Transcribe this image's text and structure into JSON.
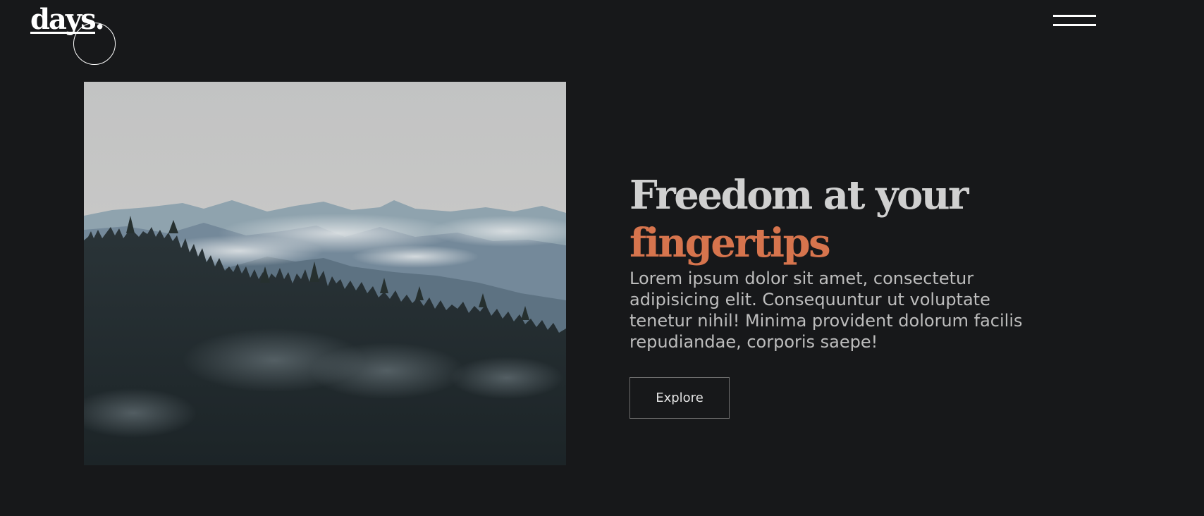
{
  "header": {
    "logo_text": "days.",
    "menu_icon": "hamburger-icon"
  },
  "hero": {
    "image_alt_icon": "mountain-forest-photo",
    "headline_line1": "Freedom at your",
    "headline_line2": "fingertips",
    "body": "Lorem ipsum dolor sit amet, consectetur adipisicing elit. Consequuntur ut voluptate tenetur nihil! Minima provident dolorum facilis repudiandae, corporis saepe!",
    "cta_label": "Explore"
  },
  "colors": {
    "background": "#17181a",
    "accent": "#d6744d",
    "headline": "#d0d0d0",
    "body_text": "#bdbdbd"
  }
}
